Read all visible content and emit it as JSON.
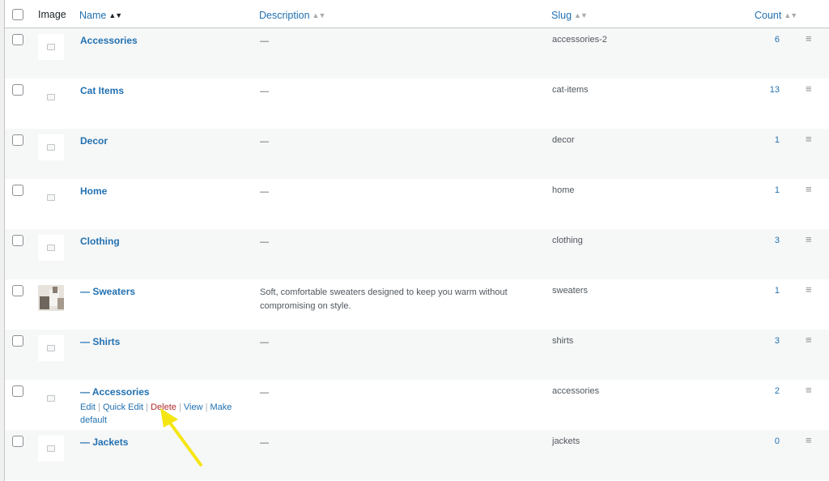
{
  "header": {
    "image": "Image",
    "name": "Name",
    "description": "Description",
    "slug": "Slug",
    "count": "Count",
    "sort_active": "▲▼",
    "sort_idle": "▲▼"
  },
  "rows": [
    {
      "name": "Accessories",
      "description": "—",
      "slug": "accessories-2",
      "count": "6"
    },
    {
      "name": "Cat Items",
      "description": "—",
      "slug": "cat-items",
      "count": "13"
    },
    {
      "name": "Decor",
      "description": "—",
      "slug": "decor",
      "count": "1"
    },
    {
      "name": "Home",
      "description": "—",
      "slug": "home",
      "count": "1"
    },
    {
      "name": "Clothing",
      "description": "—",
      "slug": "clothing",
      "count": "3"
    },
    {
      "name": "— Sweaters",
      "description": "Soft, comfortable sweaters designed to keep you warm without compromising on style.",
      "slug": "sweaters",
      "count": "1"
    },
    {
      "name": "— Shirts",
      "description": "—",
      "slug": "shirts",
      "count": "3"
    },
    {
      "name": "— Accessories",
      "description": "—",
      "slug": "accessories",
      "count": "2"
    },
    {
      "name": "— Jackets",
      "description": "—",
      "slug": "jackets",
      "count": "0"
    }
  ],
  "row_actions": {
    "edit": "Edit",
    "sep": "|",
    "quick_edit": "Quick Edit",
    "delete": "Delete",
    "view": "View",
    "make_default": "Make default"
  },
  "drag_glyph": "≡",
  "colors": {
    "link": "#2271b1",
    "delete": "#b32d2e",
    "annotation_arrow": "#f5e612"
  }
}
